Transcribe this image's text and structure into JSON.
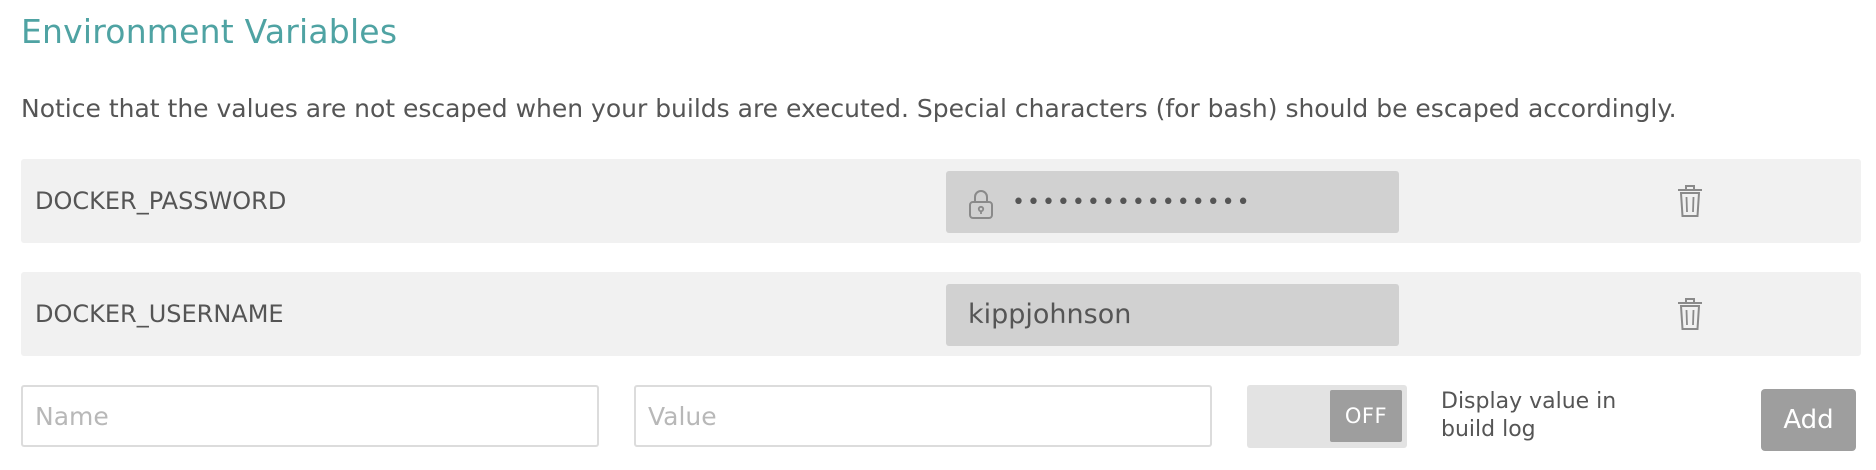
{
  "section": {
    "title": "Environment Variables",
    "notice": "Notice that the values are not escaped when your builds are executed. Special characters (for bash) should be escaped accordingly."
  },
  "env_vars": [
    {
      "name": "DOCKER_PASSWORD",
      "value": "••••••••••••••••",
      "secret": true,
      "icon": "lock-icon"
    },
    {
      "name": "DOCKER_USERNAME",
      "value": "kippjohnson",
      "secret": false
    }
  ],
  "new_var": {
    "name_placeholder": "Name",
    "value_placeholder": "Value",
    "toggle_state": "OFF",
    "toggle_label": "Display value in build log",
    "add_label": "Add"
  },
  "icons": {
    "delete": "trash-icon",
    "secret": "lock-icon"
  },
  "colors": {
    "title": "#4fa3a3",
    "row_background": "#f1f1f1",
    "value_background": "#d1d1d1",
    "button": "#9e9e9e"
  }
}
